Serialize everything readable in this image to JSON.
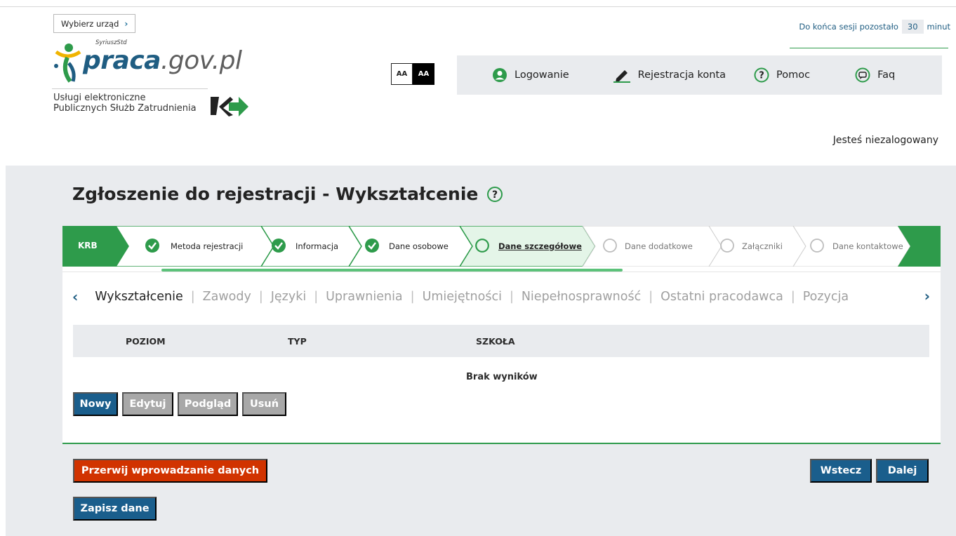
{
  "header": {
    "select_office_label": "Wybierz urząd",
    "logo_main": "praca",
    "logo_domain": ".gov.pl",
    "logo_sup": "SyriuszStd",
    "services_line1": "Usługi elektroniczne",
    "services_line2": "Publicznych Służb Zatrudnienia",
    "contrast_normal": "AA",
    "contrast_high": "AA",
    "session_prefix": "Do końca sesji pozostało",
    "session_minutes": "30",
    "session_suffix": "minut",
    "not_logged": "Jesteś niezalogowany"
  },
  "nav": {
    "items": [
      {
        "label": "Logowanie",
        "icon": "user-circle-icon"
      },
      {
        "label": "Rejestracja konta",
        "icon": "pencil-icon"
      },
      {
        "label": "Pomoc",
        "icon": "help-circle-icon"
      },
      {
        "label": "Faq",
        "icon": "chat-bubble-icon"
      }
    ]
  },
  "page": {
    "title": "Zgłoszenie do rejestracji - Wykształcenie",
    "title_icon": "help-circle-icon"
  },
  "steps": {
    "first": "KRB",
    "items": [
      {
        "label": "Metoda rejestracji",
        "status": "done"
      },
      {
        "label": "Informacja",
        "status": "done"
      },
      {
        "label": "Dane osobowe",
        "status": "done"
      },
      {
        "label": "Dane szczegółowe",
        "status": "current"
      },
      {
        "label": "Dane dodatkowe",
        "status": "pending"
      },
      {
        "label": "Załączniki",
        "status": "pending"
      },
      {
        "label": "Dane kontaktowe",
        "status": "pending"
      }
    ]
  },
  "tabs": {
    "items": [
      "Wykształcenie",
      "Zawody",
      "Języki",
      "Uprawnienia",
      "Umiejętności",
      "Niepełnosprawność",
      "Ostatni pracodawca",
      "Pozycja"
    ],
    "active": 0
  },
  "table": {
    "columns": [
      "POZIOM",
      "TYP",
      "SZKOŁA"
    ],
    "rows": [],
    "empty_text": "Brak wyników"
  },
  "actions": {
    "new": "Nowy",
    "edit": "Edytuj",
    "preview": "Podgląd",
    "delete": "Usuń"
  },
  "footer": {
    "abort": "Przerwij wprowadzanie danych",
    "save": "Zapisz dane",
    "back": "Wstecz",
    "next": "Dalej"
  },
  "colors": {
    "primary_blue": "#1a5e8c",
    "green": "#2e9b4b",
    "red": "#d13300",
    "disabled_gray": "#a8a8a8",
    "panel_gray": "#e9ebee"
  }
}
